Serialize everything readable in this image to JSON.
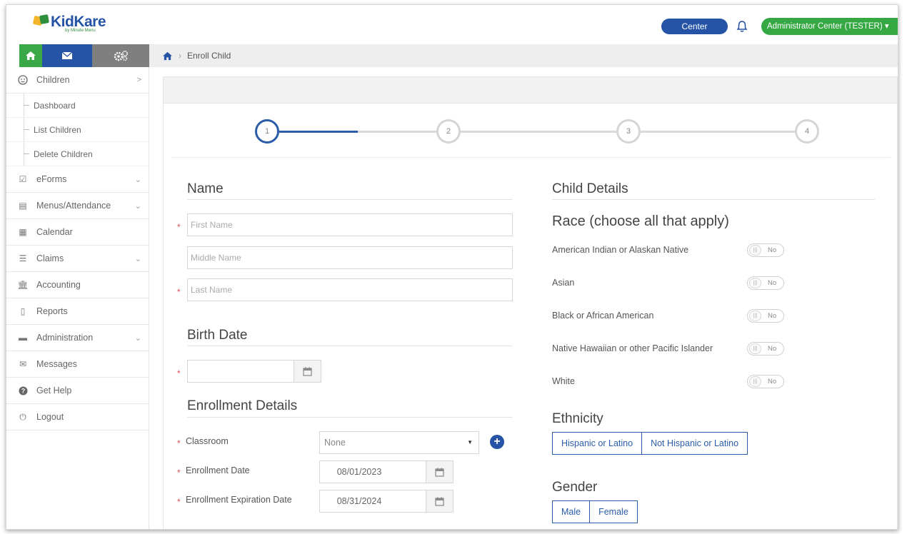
{
  "header": {
    "logo_text": "KidKare",
    "logo_sub": "by Minute Menu",
    "center_button": "Center",
    "admin_button": "Administrator Center (TESTER)"
  },
  "breadcrumb": {
    "current": "Enroll Child"
  },
  "sidebar": {
    "items": [
      {
        "label": "Children"
      },
      {
        "label": "eForms"
      },
      {
        "label": "Menus/Attendance"
      },
      {
        "label": "Calendar"
      },
      {
        "label": "Claims"
      },
      {
        "label": "Accounting"
      },
      {
        "label": "Reports"
      },
      {
        "label": "Administration"
      },
      {
        "label": "Messages"
      },
      {
        "label": "Get Help"
      },
      {
        "label": "Logout"
      }
    ],
    "children_sub": [
      {
        "label": "Dashboard"
      },
      {
        "label": "List Children"
      },
      {
        "label": "Delete Children"
      }
    ]
  },
  "stepper": {
    "steps": [
      "1",
      "2",
      "3",
      "4"
    ],
    "active_step": 1
  },
  "form": {
    "name_section": "Name",
    "first_name_placeholder": "First Name",
    "middle_name_placeholder": "Middle Name",
    "last_name_placeholder": "Last Name",
    "birth_date_section": "Birth Date",
    "enrollment_section": "Enrollment Details",
    "classroom_label": "Classroom",
    "classroom_value": "None",
    "enrollment_date_label": "Enrollment Date",
    "enrollment_date_value": "08/01/2023",
    "expiration_date_label": "Enrollment Expiration Date",
    "expiration_date_value": "08/31/2024"
  },
  "child_details": {
    "title": "Child Details",
    "race_title": "Race (choose all that apply)",
    "races": [
      {
        "label": "American Indian or Alaskan Native",
        "value": "No"
      },
      {
        "label": "Asian",
        "value": "No"
      },
      {
        "label": "Black or African American",
        "value": "No"
      },
      {
        "label": "Native Hawaiian or other Pacific Islander",
        "value": "No"
      },
      {
        "label": "White",
        "value": "No"
      }
    ],
    "ethnicity_title": "Ethnicity",
    "ethnicity_options": [
      "Hispanic or Latino",
      "Not Hispanic or Latino"
    ],
    "gender_title": "Gender",
    "gender_options": [
      "Male",
      "Female"
    ]
  },
  "colors": {
    "brand_blue": "#2553a6",
    "brand_green": "#35a844",
    "required_red": "#d9534f"
  }
}
